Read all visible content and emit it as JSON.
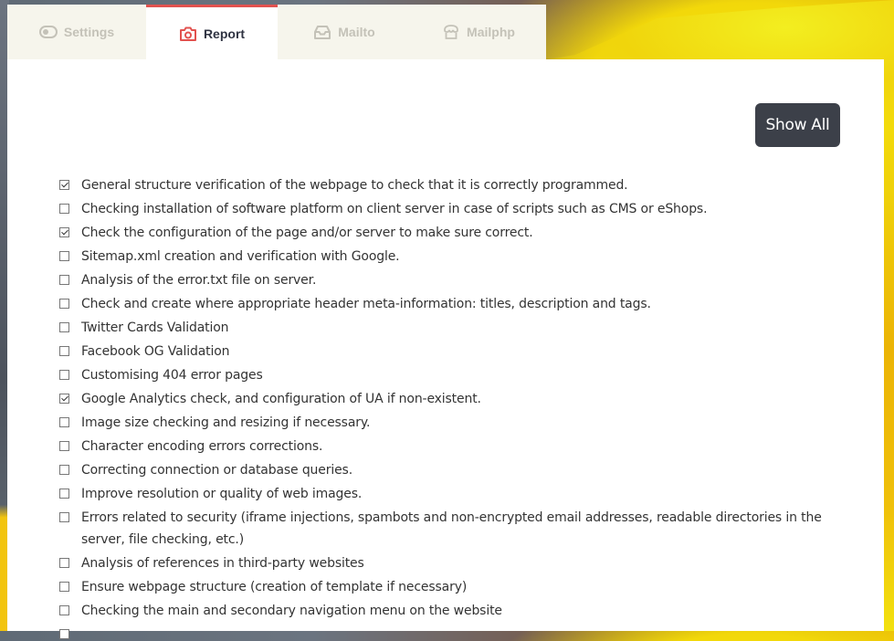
{
  "tabs": [
    {
      "label": "Settings",
      "icon": "toggle-icon",
      "active": false
    },
    {
      "label": "Report",
      "icon": "camera-icon",
      "active": true
    },
    {
      "label": "Mailto",
      "icon": "inbox-icon",
      "active": false
    },
    {
      "label": "Mailphp",
      "icon": "store-icon",
      "active": false
    }
  ],
  "colors": {
    "accent": "#e2524f",
    "tab_bar_bg": "#f6f5ec",
    "button_bg": "#3c4049"
  },
  "report": {
    "show_all_label": "Show All",
    "items": [
      {
        "label": "General structure verification of the webpage to check that it is correctly programmed.",
        "checked": true
      },
      {
        "label": "Checking installation of software platform on client server in case of scripts such as CMS or eShops.",
        "checked": false
      },
      {
        "label": "Check the configuration of the page and/or server to make sure correct.",
        "checked": true
      },
      {
        "label": "Sitemap.xml creation and verification with Google.",
        "checked": false
      },
      {
        "label": "Analysis of the error.txt file on server.",
        "checked": false
      },
      {
        "label": "Check and create where appropriate header meta-information: titles, description and tags.",
        "checked": false
      },
      {
        "label": "Twitter Cards Validation",
        "checked": false
      },
      {
        "label": "Facebook OG Validation",
        "checked": false
      },
      {
        "label": "Customising 404 error pages",
        "checked": false
      },
      {
        "label": "Google Analytics check, and configuration of UA if non-existent.",
        "checked": true
      },
      {
        "label": "Image size checking and resizing if necessary.",
        "checked": false
      },
      {
        "label": "Character encoding errors corrections.",
        "checked": false
      },
      {
        "label": "Correcting connection or database queries.",
        "checked": false
      },
      {
        "label": "Improve resolution or quality of web images.",
        "checked": false
      },
      {
        "label": "Errors related to security (iframe injections, spambots and non-encrypted email addresses, readable directories in the server, file checking, etc.)",
        "checked": false
      },
      {
        "label": "Analysis of references in third-party websites",
        "checked": false
      },
      {
        "label": "Ensure webpage structure (creation of template if necessary)",
        "checked": false
      },
      {
        "label": "Checking the main and secondary navigation menu on the website",
        "checked": false
      },
      {
        "label": "",
        "checked": false
      }
    ]
  }
}
